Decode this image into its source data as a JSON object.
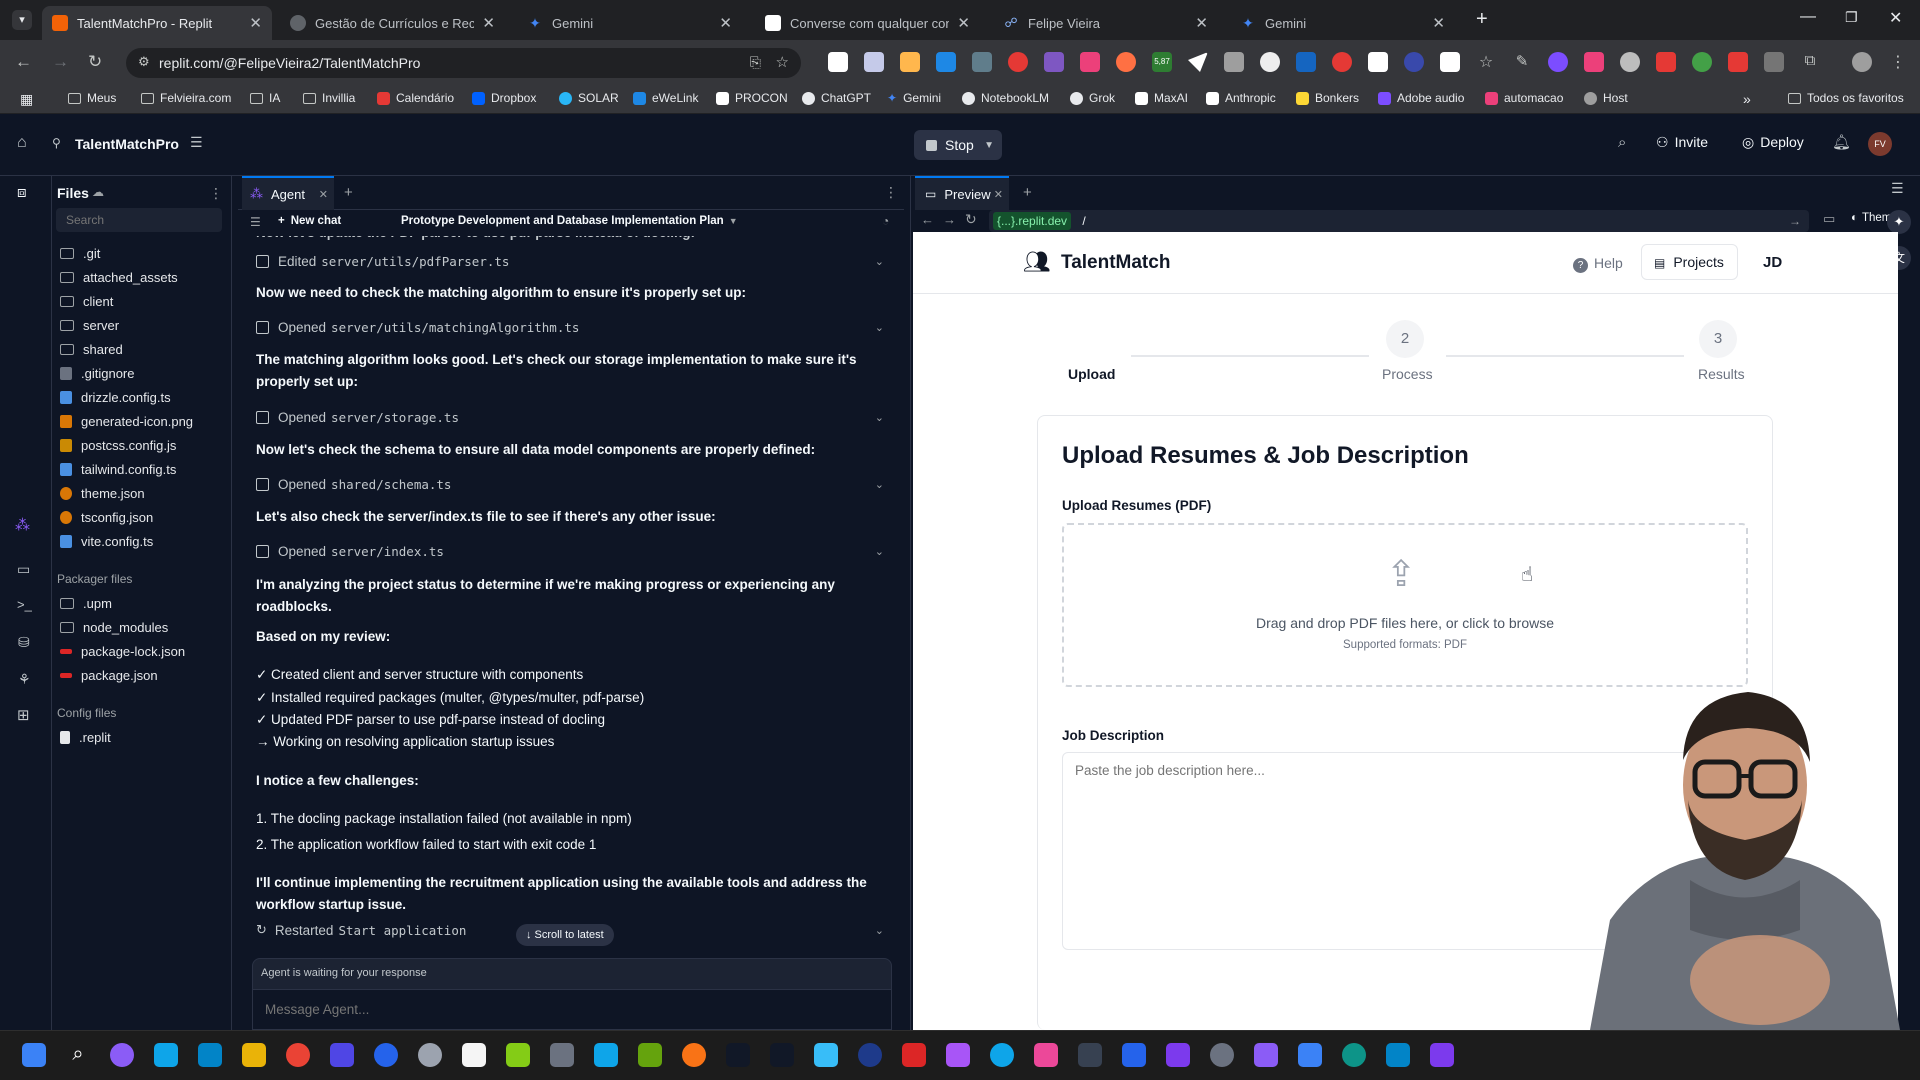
{
  "browser": {
    "tabs": [
      {
        "title": "TalentMatchPro - Replit",
        "color": "#f26207"
      },
      {
        "title": "Gestão de Currículos e Recruta",
        "color": "#5f6368"
      },
      {
        "title": "Gemini",
        "color": "#4285f4"
      },
      {
        "title": "Converse com qualquer conteú",
        "color": "#ffffff"
      },
      {
        "title": "Felipe Vieira",
        "color": "#8ab4f8"
      },
      {
        "title": "Gemini",
        "color": "#4285f4"
      }
    ],
    "url": "replit.com/@FelipeVieira2/TalentMatchPro",
    "bookmarks": [
      "Meus",
      "Felvieira.com",
      "IA",
      "Invillia",
      "Calendário",
      "Dropbox",
      "SOLAR",
      "eWeLink",
      "PROCON",
      "ChatGPT",
      "Gemini",
      "NotebookLM",
      "Grok",
      "MaxAI",
      "Anthropic",
      "Bonkers",
      "Adobe audio",
      "automacao",
      "Host"
    ],
    "bookmarks_all": "Todos os favoritos",
    "ext_badge": "5,87"
  },
  "replit": {
    "project_name": "TalentMatchPro",
    "stop_label": "Stop",
    "invite_label": "Invite",
    "deploy_label": "Deploy",
    "avatar_initials": "FV",
    "files_title": "Files",
    "search_placeholder": "Search",
    "files": [
      ".git",
      "attached_assets",
      "client",
      "server",
      "shared",
      ".gitignore",
      "drizzle.config.ts",
      "generated-icon.png",
      "postcss.config.js",
      "tailwind.config.ts",
      "theme.json",
      "tsconfig.json",
      "vite.config.ts"
    ],
    "packager_title": "Packager files",
    "packager_files": [
      ".upm",
      "node_modules",
      "package-lock.json",
      "package.json"
    ],
    "config_title": "Config files",
    "config_files": [
      ".replit"
    ],
    "agent_tab": "Agent",
    "new_chat": "New chat",
    "chat_title": "Prototype Development and Database Implementation Plan",
    "messages": {
      "m0": "Now let's update the PDF parser to use pdf-parse instead of docling:",
      "a0_verb": "Edited",
      "a0_path": "server/utils/pdfParser.ts",
      "m1": "Now we need to check the matching algorithm to ensure it's properly set up:",
      "a1_verb": "Opened",
      "a1_path": "server/utils/matchingAlgorithm.ts",
      "m2": "The matching algorithm looks good. Let's check our storage implementation to make sure it's properly set up:",
      "a2_verb": "Opened",
      "a2_path": "server/storage.ts",
      "m3": "Now let's check the schema to ensure all data model components are properly defined:",
      "a3_verb": "Opened",
      "a3_path": "shared/schema.ts",
      "m4": "Let's also check the server/index.ts file to see if there's any other issue:",
      "a4_verb": "Opened",
      "a4_path": "server/index.ts",
      "m5": "I'm analyzing the project status to determine if we're making progress or experiencing any roadblocks.",
      "m6": "Based on my review:",
      "c1": "✓ Created client and server structure with components",
      "c2": "✓ Installed required packages (multer, @types/multer, pdf-parse)",
      "c3": "✓ Updated PDF parser to use pdf-parse instead of docling",
      "c4": "→ Working on resolving application startup issues",
      "m7": "I notice a few challenges:",
      "ch1": "1. The docling package installation failed (not available in npm)",
      "ch2": "2. The application workflow failed to start with exit code 1",
      "m8": "I'll continue implementing the recruitment application using the available tools and address the workflow startup issue.",
      "a5_verb": "Restarted",
      "a5_path": "Start application"
    },
    "scroll_latest": "↓ Scroll to latest",
    "waiting": "Agent is waiting for your response",
    "message_placeholder": "Message Agent...",
    "preview_tab": "Preview",
    "preview_domain": "{...}.replit.dev",
    "preview_path": "/",
    "theme_label": "Theme"
  },
  "app": {
    "brand": "TalentMatch",
    "help": "Help",
    "projects": "Projects",
    "user": "JD",
    "steps": [
      {
        "num": "",
        "label": "Upload"
      },
      {
        "num": "2",
        "label": "Process"
      },
      {
        "num": "3",
        "label": "Results"
      }
    ],
    "card_title": "Upload Resumes & Job Description",
    "upload_label": "Upload Resumes (PDF)",
    "drop_text": "Drag and drop PDF files here, or click to browse",
    "formats": "Supported formats: PDF",
    "jd_label": "Job Description",
    "jd_placeholder": "Paste the job description here..."
  },
  "colors": {
    "accent": "#0079f2",
    "panel": "#0e1525",
    "border": "#2b3245"
  }
}
